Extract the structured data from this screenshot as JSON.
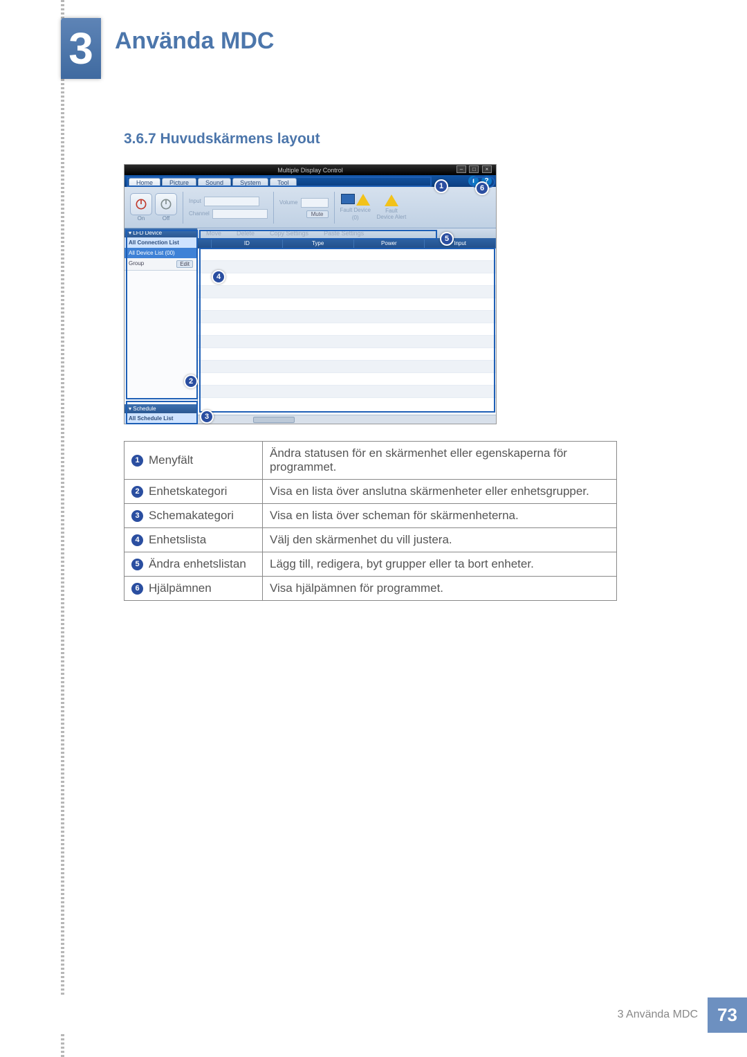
{
  "chapter": {
    "number": "3",
    "title": "Använda MDC"
  },
  "section": {
    "number_title": "3.6.7  Huvudskärmens layout"
  },
  "screenshot": {
    "window_title": "Multiple Display Control",
    "window_buttons": {
      "min": "–",
      "max": "□",
      "close": "×"
    },
    "tabs": [
      "Home",
      "Picture",
      "Sound",
      "System",
      "Tool"
    ],
    "help": {
      "info": "i",
      "q": "?"
    },
    "toolbar": {
      "on": "On",
      "off": "Off",
      "input_label": "Input",
      "channel_label": "Channel",
      "volume_label": "Volume",
      "mute_label": "Mute",
      "fault_device": "Fault Device",
      "fault_count": "(0)",
      "fault_alert": "Fault Device Alert"
    },
    "sidebar": {
      "lfd_header": "▾  LFD Device",
      "conn_list": "All Connection List",
      "dev_list": "All Device List (00)",
      "group": "Group",
      "edit": "Edit",
      "schedule_header": "▾  Schedule",
      "sched_list": "All Schedule List"
    },
    "actions": {
      "move": "Move",
      "delete": "Delete",
      "copy": "Copy Settings",
      "paste": "Paste Settings"
    },
    "columns": [
      "",
      "ID",
      "Type",
      "Power",
      "Input"
    ]
  },
  "callouts": {
    "c1": "1",
    "c2": "2",
    "c3": "3",
    "c4": "4",
    "c5": "5",
    "c6": "6"
  },
  "legend": [
    {
      "n": "1",
      "label": "Menyfält",
      "desc": "Ändra statusen för en skärmenhet eller egenskaperna för programmet."
    },
    {
      "n": "2",
      "label": "Enhetskategori",
      "desc": "Visa en lista över anslutna skärmenheter eller enhetsgrupper."
    },
    {
      "n": "3",
      "label": "Schemakategori",
      "desc": "Visa en lista över scheman för skärmenheterna."
    },
    {
      "n": "4",
      "label": "Enhetslista",
      "desc": "Välj den skärmenhet du vill justera."
    },
    {
      "n": "5",
      "label": "Ändra enhetslistan",
      "desc": "Lägg till, redigera, byt grupper eller ta bort enheter."
    },
    {
      "n": "6",
      "label": "Hjälpämnen",
      "desc": "Visa hjälpämnen för programmet."
    }
  ],
  "footer": {
    "text": "3 Använda MDC",
    "page": "73"
  }
}
